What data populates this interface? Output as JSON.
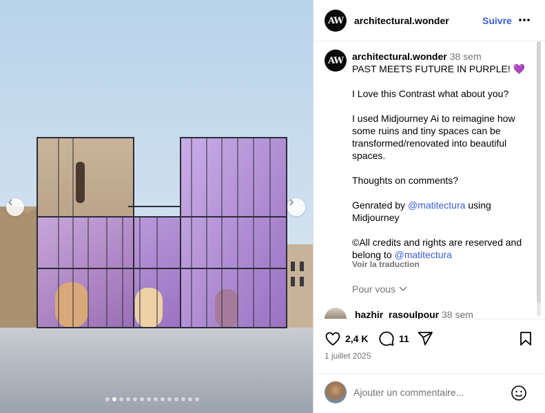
{
  "post": {
    "username": "architectural.wonder",
    "avatar_text": "AW",
    "follow_label": "Suivre",
    "more_icon": "more-horizontal-icon"
  },
  "media": {
    "slide_count": 14,
    "active_slide": 1,
    "prev_icon": "chevron-left-icon",
    "next_icon": "chevron-right-icon"
  },
  "caption": {
    "username": "architectural.wonder",
    "time": "38 sem",
    "line1": "PAST MEETS FUTURE IN PURPLE! 💜",
    "line2": "I Love this Contrast what about you?",
    "line3": "I used Midjourney Ai to reimagine how some ruins and tiny spaces can be transformed/renovated into beautiful spaces.",
    "line4": "Thoughts on comments?",
    "line5_prefix": "Genrated by",
    "line5_mention": "@matitectura",
    "line5_suffix": "using Midjourney",
    "line6_prefix": "©All credits and rights are reserved and belong to",
    "line6_mention": "@matitectura",
    "translate": "Voir la traduction",
    "for_you": "Pour vous"
  },
  "comments": [
    {
      "username": "hazhir_rasoulpour",
      "time": "38 sem"
    }
  ],
  "actions": {
    "likes": "2,4 K",
    "comments": "11",
    "date": "1 juillet 2025"
  },
  "add_comment": {
    "placeholder": "Ajouter un commentaire..."
  },
  "colors": {
    "link": "#3b5bdb",
    "muted": "#737373",
    "divider": "#efefef"
  }
}
